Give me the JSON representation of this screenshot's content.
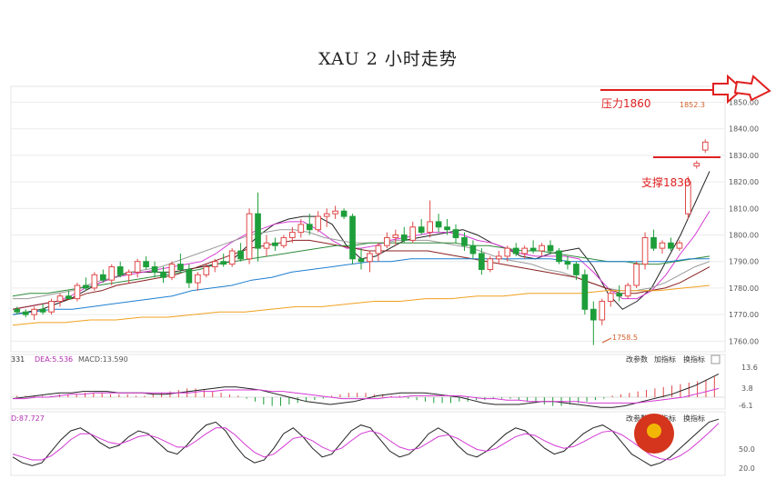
{
  "title": "XAU 2 小时走势",
  "chart_data": {
    "type": "candlestick",
    "title": "XAU 2 小时走势",
    "yaxis_ticks": [
      1760,
      1770,
      1780,
      1790,
      1800,
      1810,
      1820,
      1830,
      1840,
      1850
    ],
    "ylim": [
      1756,
      1856
    ],
    "annotations": {
      "resistance": "压力1860",
      "support": "支撑1830",
      "high_label": "1852.3",
      "low_label": "1758.5",
      "resistance_level": 1852,
      "support_level": 1830
    },
    "candles": [
      [
        1772,
        1773,
        1770,
        1771
      ],
      [
        1771,
        1772,
        1769,
        1770
      ],
      [
        1770,
        1773,
        1768,
        1772
      ],
      [
        1772,
        1774,
        1770,
        1771
      ],
      [
        1771,
        1776,
        1770,
        1775
      ],
      [
        1775,
        1778,
        1773,
        1777
      ],
      [
        1777,
        1779,
        1776,
        1776
      ],
      [
        1776,
        1782,
        1775,
        1781
      ],
      [
        1781,
        1784,
        1779,
        1780
      ],
      [
        1780,
        1786,
        1779,
        1785
      ],
      [
        1785,
        1787,
        1782,
        1783
      ],
      [
        1783,
        1789,
        1781,
        1788
      ],
      [
        1788,
        1790,
        1784,
        1785
      ],
      [
        1785,
        1787,
        1782,
        1786
      ],
      [
        1786,
        1791,
        1784,
        1790
      ],
      [
        1790,
        1792,
        1787,
        1788
      ],
      [
        1788,
        1790,
        1784,
        1786
      ],
      [
        1786,
        1788,
        1782,
        1784
      ],
      [
        1784,
        1790,
        1783,
        1789
      ],
      [
        1789,
        1793,
        1786,
        1787
      ],
      [
        1787,
        1789,
        1780,
        1782
      ],
      [
        1782,
        1786,
        1779,
        1785
      ],
      [
        1785,
        1789,
        1784,
        1788
      ],
      [
        1788,
        1791,
        1786,
        1790
      ],
      [
        1790,
        1793,
        1788,
        1789
      ],
      [
        1789,
        1795,
        1788,
        1794
      ],
      [
        1794,
        1797,
        1790,
        1791
      ],
      [
        1791,
        1810,
        1789,
        1808
      ],
      [
        1808,
        1816,
        1790,
        1795
      ],
      [
        1795,
        1800,
        1792,
        1797
      ],
      [
        1797,
        1799,
        1794,
        1796
      ],
      [
        1796,
        1800,
        1795,
        1799
      ],
      [
        1799,
        1803,
        1797,
        1801
      ],
      [
        1801,
        1806,
        1799,
        1804
      ],
      [
        1804,
        1808,
        1800,
        1802
      ],
      [
        1802,
        1809,
        1801,
        1807
      ],
      [
        1807,
        1810,
        1803,
        1808
      ],
      [
        1808,
        1811,
        1806,
        1809
      ],
      [
        1809,
        1810,
        1806,
        1807
      ],
      [
        1807,
        1808,
        1789,
        1791
      ],
      [
        1791,
        1795,
        1787,
        1790
      ],
      [
        1790,
        1794,
        1786,
        1793
      ],
      [
        1793,
        1797,
        1790,
        1796
      ],
      [
        1796,
        1801,
        1795,
        1799
      ],
      [
        1799,
        1802,
        1796,
        1800
      ],
      [
        1800,
        1803,
        1797,
        1798
      ],
      [
        1798,
        1805,
        1797,
        1803
      ],
      [
        1803,
        1806,
        1800,
        1801
      ],
      [
        1801,
        1813,
        1799,
        1805
      ],
      [
        1805,
        1808,
        1801,
        1803
      ],
      [
        1803,
        1806,
        1800,
        1802
      ],
      [
        1802,
        1804,
        1797,
        1799
      ],
      [
        1799,
        1801,
        1794,
        1796
      ],
      [
        1796,
        1798,
        1791,
        1793
      ],
      [
        1793,
        1795,
        1785,
        1787
      ],
      [
        1787,
        1792,
        1786,
        1791
      ],
      [
        1791,
        1794,
        1789,
        1792
      ],
      [
        1792,
        1796,
        1790,
        1795
      ],
      [
        1795,
        1797,
        1792,
        1793
      ],
      [
        1793,
        1796,
        1791,
        1795
      ],
      [
        1795,
        1798,
        1793,
        1794
      ],
      [
        1794,
        1797,
        1792,
        1796
      ],
      [
        1796,
        1798,
        1793,
        1794
      ],
      [
        1794,
        1795,
        1789,
        1790
      ],
      [
        1790,
        1792,
        1787,
        1789
      ],
      [
        1789,
        1790,
        1783,
        1785
      ],
      [
        1785,
        1787,
        1770,
        1772
      ],
      [
        1772,
        1775,
        1758.5,
        1768
      ],
      [
        1768,
        1776,
        1766,
        1775
      ],
      [
        1775,
        1779,
        1773,
        1778
      ],
      [
        1778,
        1781,
        1775,
        1777
      ],
      [
        1777,
        1782,
        1776,
        1781
      ],
      [
        1781,
        1790,
        1780,
        1789
      ],
      [
        1789,
        1801,
        1787,
        1799
      ],
      [
        1799,
        1802,
        1794,
        1795
      ],
      [
        1795,
        1798,
        1793,
        1797
      ],
      [
        1797,
        1799,
        1794,
        1795
      ],
      [
        1795,
        1798,
        1794,
        1797
      ],
      [
        1808,
        1822,
        1806,
        1820
      ],
      [
        1826,
        1828,
        1825,
        1827
      ],
      [
        1832,
        1836,
        1831,
        1835
      ]
    ],
    "ma_lines": {
      "ma_black": [
        1770,
        1771,
        1772,
        1774,
        1776,
        1779,
        1782,
        1784,
        1786,
        1786,
        1786,
        1786,
        1787,
        1788,
        1789,
        1790,
        1795,
        1800,
        1804,
        1806,
        1807,
        1807,
        1804,
        1796,
        1791,
        1792,
        1795,
        1798,
        1799,
        1800,
        1801,
        1802,
        1800,
        1797,
        1795,
        1792,
        1791,
        1793,
        1794,
        1795,
        1788,
        1778,
        1772,
        1775,
        1780,
        1790,
        1800,
        1812,
        1824
      ],
      "ma_magenta": [
        1772,
        1773,
        1774,
        1775,
        1777,
        1780,
        1782,
        1784,
        1785,
        1786,
        1787,
        1788,
        1789,
        1790,
        1793,
        1797,
        1800,
        1802,
        1804,
        1805,
        1805,
        1802,
        1798,
        1795,
        1795,
        1796,
        1798,
        1799,
        1800,
        1801,
        1801,
        1800,
        1798,
        1797,
        1795,
        1793,
        1792,
        1792,
        1792,
        1791,
        1786,
        1780,
        1776,
        1776,
        1779,
        1785,
        1793,
        1800,
        1809
      ],
      "ma_gray": [
        1776,
        1776,
        1777,
        1778,
        1779,
        1781,
        1783,
        1784,
        1786,
        1787,
        1788,
        1790,
        1792,
        1794,
        1796,
        1798,
        1800,
        1801,
        1802,
        1802,
        1801,
        1799,
        1798,
        1797,
        1797,
        1797,
        1798,
        1798,
        1798,
        1797,
        1796,
        1795,
        1793,
        1791,
        1790,
        1789,
        1787,
        1786,
        1784,
        1782,
        1780,
        1779,
        1779,
        1780,
        1782,
        1785,
        1788,
        1790
      ],
      "ma_darkred": [
        1772,
        1773,
        1774,
        1775,
        1776,
        1778,
        1779,
        1781,
        1782,
        1783,
        1784,
        1785,
        1787,
        1789,
        1791,
        1793,
        1795,
        1796,
        1797,
        1798,
        1798,
        1797,
        1796,
        1795,
        1794,
        1794,
        1794,
        1794,
        1794,
        1793,
        1792,
        1791,
        1790,
        1789,
        1788,
        1787,
        1786,
        1785,
        1784,
        1782,
        1780,
        1778,
        1778,
        1779,
        1780,
        1782,
        1785,
        1788
      ],
      "ma_green": [
        1777,
        1778,
        1778,
        1779,
        1780,
        1781,
        1782,
        1783,
        1784,
        1785,
        1786,
        1787,
        1789,
        1790,
        1791,
        1792,
        1793,
        1794,
        1795,
        1796,
        1796,
        1797,
        1797,
        1797,
        1797,
        1797,
        1797,
        1796,
        1796,
        1795,
        1794,
        1794,
        1793,
        1792,
        1791,
        1790,
        1790,
        1789,
        1789,
        1790,
        1791,
        1792
      ],
      "ma_blue": [
        1770,
        1771,
        1772,
        1772,
        1773,
        1774,
        1775,
        1776,
        1777,
        1779,
        1780,
        1781,
        1783,
        1784,
        1786,
        1787,
        1788,
        1789,
        1790,
        1790,
        1791,
        1791,
        1791,
        1791,
        1791,
        1791,
        1791,
        1791,
        1790,
        1790,
        1790,
        1790,
        1790,
        1790,
        1791,
        1791
      ],
      "ma_orange": [
        1766,
        1767,
        1767,
        1768,
        1768,
        1769,
        1769,
        1770,
        1771,
        1771,
        1772,
        1773,
        1773,
        1774,
        1775,
        1775,
        1776,
        1776,
        1777,
        1777,
        1778,
        1778,
        1778,
        1779,
        1779,
        1779,
        1780,
        1781
      ]
    },
    "macd_panel": {
      "label_left": "331",
      "dea_label": "DEA:5.536",
      "macd_label": "MACD:13.590",
      "buttons": [
        "改参数",
        "加指标",
        "换指标"
      ],
      "ticks": [
        "13.6",
        "3.8",
        "-6.1"
      ],
      "hist": [
        1,
        1,
        1,
        1,
        1,
        2,
        2,
        2,
        3,
        3,
        3,
        2,
        2,
        2,
        1,
        1,
        2,
        3,
        4,
        5,
        6,
        6,
        5,
        4,
        3,
        2,
        1,
        -1,
        -3,
        -5,
        -6,
        -6,
        -5,
        -4,
        -3,
        -2,
        -1,
        1,
        2,
        3,
        3,
        3,
        2,
        2,
        1,
        1,
        -1,
        -2,
        -3,
        -4,
        -4,
        -4,
        -3,
        -3,
        -2,
        -2,
        -1,
        -1,
        -1,
        -2,
        -3,
        -4,
        -5,
        -6,
        -6,
        -5,
        -4,
        -3,
        -2,
        -1,
        1,
        2,
        3,
        4,
        5,
        6,
        7,
        8,
        9,
        10,
        11,
        12,
        14
      ],
      "dif": [
        -1,
        0,
        1,
        2,
        3,
        3,
        4,
        4,
        4,
        3,
        3,
        3,
        2,
        2,
        3,
        4,
        5,
        6,
        7,
        7,
        6,
        5,
        3,
        1,
        -1,
        -3,
        -4,
        -5,
        -4,
        -3,
        -1,
        1,
        2,
        3,
        3,
        3,
        2,
        1,
        0,
        -2,
        -4,
        -5,
        -5,
        -5,
        -4,
        -3,
        -3,
        -4,
        -5,
        -6,
        -7,
        -7,
        -6,
        -4,
        -2,
        0,
        2,
        5,
        8,
        12,
        16
      ],
      "dea": [
        -1,
        -1,
        0,
        0,
        1,
        2,
        2,
        3,
        3,
        3,
        3,
        3,
        3,
        3,
        3,
        3,
        4,
        4,
        5,
        5,
        5,
        5,
        4,
        4,
        3,
        2,
        1,
        0,
        -1,
        -1,
        -1,
        -1,
        0,
        0,
        1,
        1,
        1,
        1,
        1,
        0,
        -1,
        -1,
        -2,
        -2,
        -3,
        -3,
        -3,
        -3,
        -3,
        -4,
        -4,
        -4,
        -4,
        -4,
        -3,
        -2,
        -1,
        0,
        2,
        4,
        6
      ]
    },
    "kd_panel": {
      "label_left": "D:87.727",
      "buttons": [
        "改参数",
        "加指标",
        "换指标"
      ],
      "tick_mid": "50.0",
      "tick_low": "20.0",
      "k": [
        30,
        20,
        15,
        20,
        40,
        60,
        75,
        80,
        70,
        55,
        45,
        50,
        65,
        75,
        70,
        55,
        40,
        35,
        50,
        70,
        85,
        90,
        75,
        50,
        30,
        20,
        25,
        45,
        70,
        80,
        65,
        45,
        30,
        35,
        55,
        75,
        85,
        80,
        60,
        40,
        30,
        35,
        50,
        70,
        80,
        70,
        50,
        35,
        30,
        40,
        55,
        70,
        80,
        75,
        60,
        45,
        35,
        40,
        55,
        70,
        80,
        85,
        75,
        55,
        35,
        25,
        15,
        20,
        30,
        45,
        60,
        75,
        90,
        95
      ],
      "d": [
        35,
        30,
        25,
        25,
        32,
        45,
        60,
        70,
        70,
        62,
        55,
        52,
        58,
        65,
        68,
        63,
        55,
        47,
        47,
        58,
        70,
        80,
        80,
        68,
        52,
        38,
        30,
        35,
        48,
        62,
        65,
        58,
        47,
        40,
        45,
        58,
        70,
        75,
        70,
        58,
        47,
        42,
        45,
        55,
        65,
        68,
        62,
        52,
        43,
        40,
        45,
        55,
        65,
        70,
        67,
        58,
        50,
        45,
        48,
        56,
        65,
        73,
        75,
        68,
        57,
        45,
        33,
        27,
        25,
        32,
        43,
        57,
        72,
        88
      ]
    }
  }
}
